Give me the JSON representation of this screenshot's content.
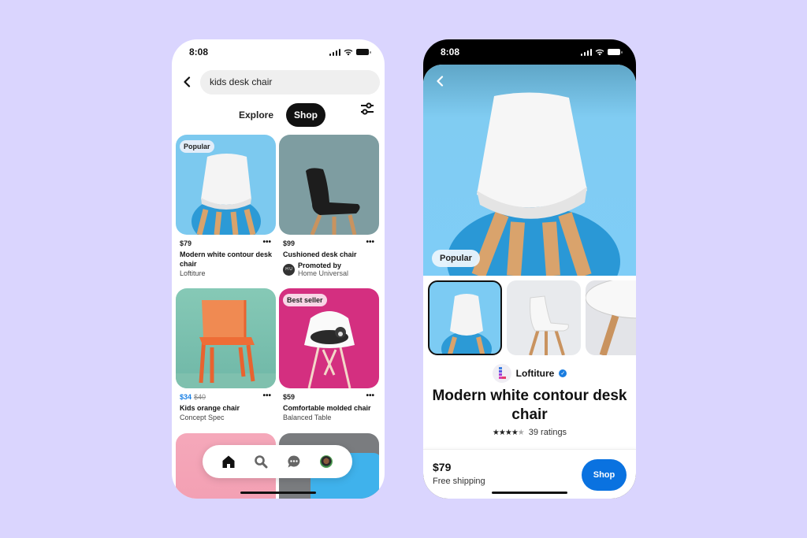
{
  "left_phone": {
    "status_bar": {
      "time": "8:08"
    },
    "search": {
      "value": "kids desk chair"
    },
    "tabs": [
      {
        "label": "Explore",
        "active": false
      },
      {
        "label": "Shop",
        "active": true
      }
    ],
    "products": [
      {
        "badge": "Popular",
        "price": "$79",
        "title": "Modern white contour desk chair",
        "seller": "Loftiture",
        "image": "white-chair-blue-bg"
      },
      {
        "badge": "",
        "price": "$99",
        "title": "Cushioned desk chair",
        "promoted_label": "Promoted by",
        "seller": "Home Universal",
        "promo_logo": "H U",
        "image": "black-chair-teal-bg"
      },
      {
        "badge": "",
        "sale_price": "$34",
        "original_price": "$40",
        "title": "Kids orange chair",
        "seller": "Concept Spec",
        "image": "orange-chair-green-bg"
      },
      {
        "badge": "Best seller",
        "price": "$59",
        "title": "Comfortable molded chair",
        "seller": "Balanced Table",
        "image": "white-chair-cat-pink-bg"
      }
    ],
    "more_label": "•••",
    "bottom_nav": [
      "home",
      "search",
      "messages",
      "profile"
    ]
  },
  "right_phone": {
    "status_bar": {
      "time": "8:08"
    },
    "hero_badge": "Popular",
    "thumbnails": [
      "chair-front-blue",
      "chair-side-grey",
      "chair-closeup"
    ],
    "merchant": {
      "name": "Loftiture",
      "verified": true
    },
    "product_title": "Modern white contour desk chair",
    "rating": {
      "stars": 4,
      "max": 5,
      "label": "39 ratings"
    },
    "buy_bar": {
      "price": "$79",
      "shipping": "Free shipping",
      "button": "Shop"
    }
  },
  "colors": {
    "background": "#DAD5FE",
    "shop_button": "#0A72E0",
    "sale_price": "#1A80E5",
    "verified": "#1A7DE0"
  }
}
